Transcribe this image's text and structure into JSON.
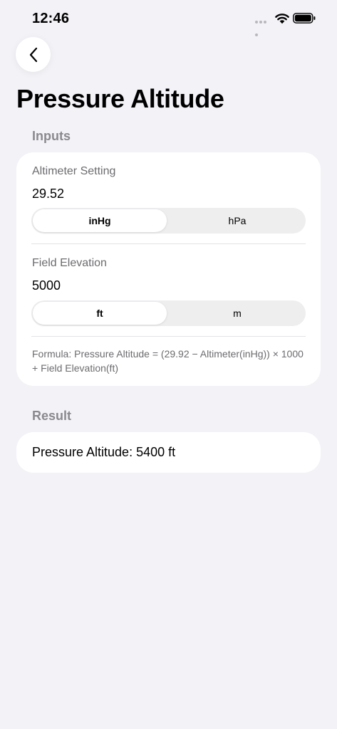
{
  "status_bar": {
    "time": "12:46"
  },
  "header": {
    "back_icon": "chevron-left-icon",
    "title": "Pressure Altitude"
  },
  "inputs_section": {
    "header": "Inputs",
    "altimeter": {
      "label": "Altimeter Setting",
      "value": "29.52",
      "units": [
        "inHg",
        "hPa"
      ],
      "selected_unit": "inHg"
    },
    "elevation": {
      "label": "Field Elevation",
      "value": "5000",
      "units": [
        "ft",
        "m"
      ],
      "selected_unit": "ft"
    },
    "formula": "Formula: Pressure Altitude = (29.92 − Altimeter(inHg)) × 1000 + Field Elevation(ft)"
  },
  "result_section": {
    "header": "Result",
    "text": "Pressure Altitude: 5400 ft"
  },
  "colors": {
    "background": "#f2f2f7",
    "card": "#ffffff",
    "secondary_text": "#8a8a8e",
    "segment_track": "#eeeeef"
  }
}
